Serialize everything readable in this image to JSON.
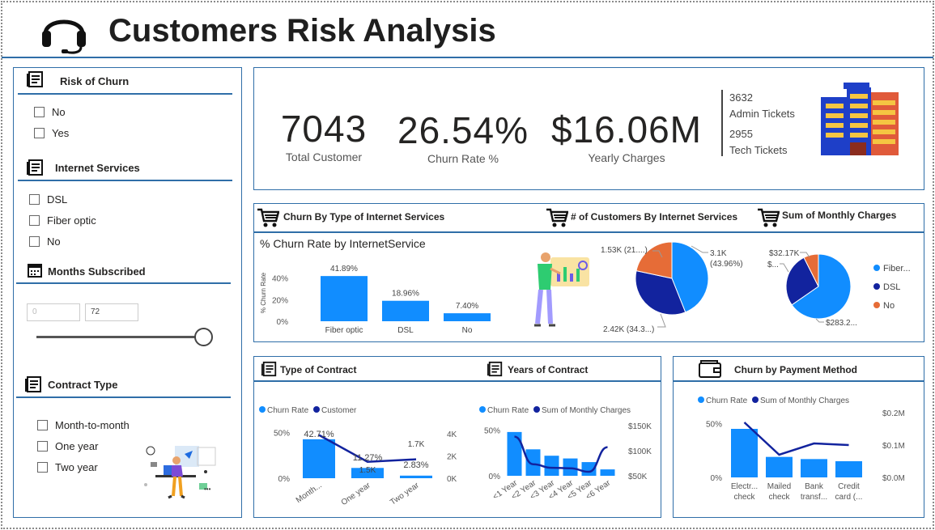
{
  "header": {
    "title": "Customers Risk Analysis"
  },
  "filters": {
    "risk": {
      "title": "Risk of Churn",
      "options": [
        "No",
        "Yes"
      ]
    },
    "internet": {
      "title": "Internet Services",
      "options": [
        "DSL",
        "Fiber optic",
        "No"
      ]
    },
    "months": {
      "title": "Months Subscribed",
      "min_value": "0",
      "max_value": "72"
    },
    "contract": {
      "title": "Contract Type",
      "options": [
        "Month-to-month",
        "One year",
        "Two year"
      ]
    }
  },
  "kpis": {
    "total_customer": {
      "value": "7043",
      "label": "Total Customer"
    },
    "churn_rate": {
      "value": "26.54%",
      "label": "Churn Rate %"
    },
    "yearly_charges": {
      "value": "$16.06M",
      "label": "Yearly Charges"
    },
    "admin_tickets": {
      "value": "3632",
      "label": "Admin Tickets"
    },
    "tech_tickets": {
      "value": "2955",
      "label": "Tech Tickets"
    }
  },
  "sections": {
    "churn_by_internet": "Churn By Type of Internet Services",
    "customers_by_internet": "# of Customers By Internet Services",
    "sum_monthly": "Sum of Monthly Charges",
    "type_of_contract": "Type of Contract",
    "years_of_contract": "Years of Contract",
    "churn_by_payment": "Churn by Payment Method"
  },
  "colors": {
    "blue": "#118dff",
    "navy": "#12239e",
    "orange": "#e66c37",
    "accent": "#2f6ea8"
  },
  "chart_data": [
    {
      "id": "churn_internet",
      "type": "bar",
      "title": "% Churn Rate by InternetService",
      "ylabel": "% Churn Rate",
      "categories": [
        "Fiber optic",
        "DSL",
        "No"
      ],
      "values": [
        41.89,
        18.96,
        7.4
      ],
      "data_labels": [
        "41.89%",
        "18.96%",
        "7.40%"
      ],
      "ylim": [
        0,
        45
      ],
      "yticks": [
        "0%",
        "20%",
        "40%"
      ]
    },
    {
      "id": "customers_pie",
      "type": "pie",
      "slices": [
        {
          "value": 3096,
          "label": "3.1K",
          "pct": "(43.96%)",
          "color": "#118dff"
        },
        {
          "value": 2421,
          "label": "2.42K (34.3...)",
          "color": "#12239e"
        },
        {
          "value": 1526,
          "label": "1.53K (21....)",
          "color": "#e66c37"
        }
      ]
    },
    {
      "id": "monthly_pie",
      "type": "pie",
      "legend": [
        "Fiber...",
        "DSL",
        "No"
      ],
      "slices": [
        {
          "value": 283.2,
          "label": "$283.2...",
          "color": "#118dff"
        },
        {
          "value": 118.0,
          "label": "$...",
          "color": "#12239e"
        },
        {
          "value": 32.17,
          "label": "$32.17K",
          "color": "#e66c37"
        }
      ]
    },
    {
      "id": "contract",
      "type": "bar",
      "legend": [
        "Churn Rate",
        "Customer"
      ],
      "categories": [
        "Month...",
        "One year",
        "Two year"
      ],
      "series": [
        {
          "name": "Churn Rate",
          "values": [
            42.71,
            11.27,
            2.83
          ],
          "labels": [
            "42.71%",
            "11.27%",
            "2.83%"
          ]
        },
        {
          "name": "Customer",
          "values": [
            3875,
            1473,
            1695
          ],
          "labels": [
            "",
            "1.5K",
            "1.7K"
          ]
        }
      ],
      "yticks_left": [
        "0%",
        "50%"
      ],
      "yticks_right": [
        "0K",
        "2K",
        "4K"
      ],
      "ylim": [
        0,
        55
      ],
      "ylim_right": [
        0,
        4500
      ]
    },
    {
      "id": "years",
      "type": "bar",
      "legend": [
        "Churn Rate",
        "Sum of Monthly Charges"
      ],
      "categories": [
        "<1 Year",
        "<2 Year",
        "<3 Year",
        "<4 Year",
        "<5 Year",
        "<6 Year"
      ],
      "series": [
        {
          "name": "Churn Rate",
          "values": [
            48,
            29,
            22,
            19,
            15,
            7
          ]
        },
        {
          "name": "Sum of Monthly Charges",
          "values": [
            128,
            73,
            66,
            65,
            58,
            107
          ]
        }
      ],
      "yticks_left": [
        "0%",
        "50%"
      ],
      "yticks_right": [
        "$50K",
        "$100K",
        "$150K"
      ],
      "ylim": [
        0,
        55
      ],
      "ylim_right": [
        50,
        150
      ]
    },
    {
      "id": "payment",
      "type": "bar",
      "legend": [
        "Churn Rate",
        "Sum of Monthly Charges"
      ],
      "categories": [
        [
          "Electr...",
          "check"
        ],
        [
          "Mailed",
          "check"
        ],
        [
          "Bank",
          "transf..."
        ],
        [
          "Credit",
          "card (..."
        ]
      ],
      "series": [
        {
          "name": "Churn Rate",
          "values": [
            45,
            19,
            17,
            15
          ]
        },
        {
          "name": "Sum of Monthly Charges",
          "values": [
            0.17,
            0.07,
            0.105,
            0.1
          ]
        }
      ],
      "yticks_left": [
        "0%",
        "50%"
      ],
      "yticks_right": [
        "$0.0M",
        "$0.1M",
        "$0.2M"
      ],
      "ylim": [
        0,
        60
      ],
      "ylim_right": [
        0,
        0.2
      ]
    }
  ]
}
